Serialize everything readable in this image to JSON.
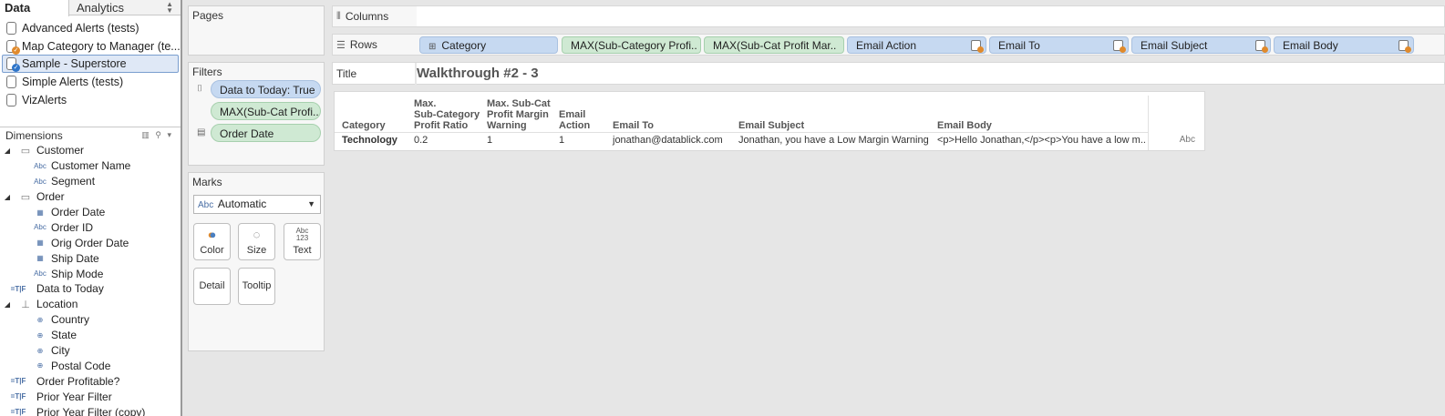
{
  "tabs": {
    "data": "Data",
    "analytics": "Analytics"
  },
  "datasources": [
    {
      "label": "Advanced Alerts (tests)",
      "icon": "database-icon",
      "badge": ""
    },
    {
      "label": "Map Category to Manager (te...",
      "icon": "database-icon",
      "badge": "orange-check"
    },
    {
      "label": "Sample - Superstore",
      "icon": "database-icon",
      "badge": "blue-check"
    },
    {
      "label": "Simple Alerts (tests)",
      "icon": "database-icon",
      "badge": ""
    },
    {
      "label": "VizAlerts",
      "icon": "database-icon",
      "badge": ""
    }
  ],
  "dimensions": {
    "header": "Dimensions",
    "fields": [
      {
        "label": "Customer",
        "type": "folder",
        "icon": "folder-icon",
        "glyph": "▭"
      },
      {
        "label": "Customer Name",
        "type": "abc",
        "icon": "abc-icon",
        "glyph": "Abc"
      },
      {
        "label": "Segment",
        "type": "abc",
        "icon": "abc-icon",
        "glyph": "Abc"
      },
      {
        "label": "Order",
        "type": "folder",
        "icon": "folder-icon",
        "glyph": "▭"
      },
      {
        "label": "Order Date",
        "type": "date",
        "icon": "calendar-icon",
        "glyph": "▦"
      },
      {
        "label": "Order ID",
        "type": "abc",
        "icon": "abc-icon",
        "glyph": "Abc"
      },
      {
        "label": "Orig Order Date",
        "type": "date",
        "icon": "calendar-icon",
        "glyph": "▦"
      },
      {
        "label": "Ship Date",
        "type": "date",
        "icon": "calendar-icon",
        "glyph": "▦"
      },
      {
        "label": "Ship Mode",
        "type": "abc",
        "icon": "abc-icon",
        "glyph": "Abc"
      },
      {
        "label": "Data to Today",
        "type": "tf",
        "icon": "boolean-icon",
        "glyph": "=T|F"
      },
      {
        "label": "Location",
        "type": "folder",
        "icon": "hierarchy-icon",
        "glyph": "⊥"
      },
      {
        "label": "Country",
        "type": "geo",
        "icon": "globe-icon",
        "glyph": "⊕"
      },
      {
        "label": "State",
        "type": "geo",
        "icon": "globe-icon",
        "glyph": "⊕"
      },
      {
        "label": "City",
        "type": "geo",
        "icon": "globe-icon",
        "glyph": "⊕"
      },
      {
        "label": "Postal Code",
        "type": "geo",
        "icon": "globe-icon",
        "glyph": "⊕"
      },
      {
        "label": "Order Profitable?",
        "type": "tf",
        "icon": "boolean-icon",
        "glyph": "=T|F"
      },
      {
        "label": "Prior Year Filter",
        "type": "tf",
        "icon": "boolean-icon",
        "glyph": "=T|F"
      },
      {
        "label": "Prior Year Filter (copy)",
        "type": "tf",
        "icon": "boolean-icon",
        "glyph": "=T|F"
      }
    ]
  },
  "pages": {
    "title": "Pages"
  },
  "filters": {
    "title": "Filters",
    "items": [
      {
        "label": "Data to Today: True",
        "color": "blue"
      },
      {
        "label": "MAX(Sub-Cat Profi..",
        "color": "green"
      },
      {
        "label": "Order Date",
        "color": "green"
      }
    ]
  },
  "marks": {
    "title": "Marks",
    "type_value": "Automatic",
    "abc": "Abc",
    "buttons": {
      "color": "Color",
      "size": "Size",
      "text": "Text",
      "detail": "Detail",
      "tooltip": "Tooltip"
    }
  },
  "shelves": {
    "columns_label": "Columns",
    "rows_label": "Rows",
    "title_label": "Title",
    "rows_pills": [
      {
        "label": "Category",
        "color": "blue",
        "plus": true
      },
      {
        "label": "MAX(Sub-Category Profi..",
        "color": "green"
      },
      {
        "label": "MAX(Sub-Cat Profit Mar..",
        "color": "green"
      },
      {
        "label": "Email Action",
        "color": "blue",
        "icon": true
      },
      {
        "label": "Email To",
        "color": "blue",
        "icon": true
      },
      {
        "label": "Email Subject",
        "color": "blue",
        "icon": true
      },
      {
        "label": "Email Body",
        "color": "blue",
        "icon": true
      }
    ]
  },
  "sheet_title": "Walkthrough #2 - 3",
  "table": {
    "headers": [
      "Category",
      "Max.\nSub-Category\nProfit Ratio",
      "Max. Sub-Cat\nProfit Margin\nWarning",
      "Email\nAction",
      "Email To",
      "Email Subject",
      "Email Body"
    ],
    "row": [
      "Technology",
      "0.2",
      "1",
      "1",
      "jonathan@datablick.com",
      "Jonathan, you have a Low Margin Warning",
      "<p>Hello Jonathan,</p><p>You have a low m.."
    ],
    "abc_cell": "Abc"
  },
  "colors": {
    "pill_blue": "#c6d9f1",
    "pill_green": "#cfe9d3",
    "badge_orange": "#e08a2c",
    "badge_blue": "#2e75c9"
  }
}
